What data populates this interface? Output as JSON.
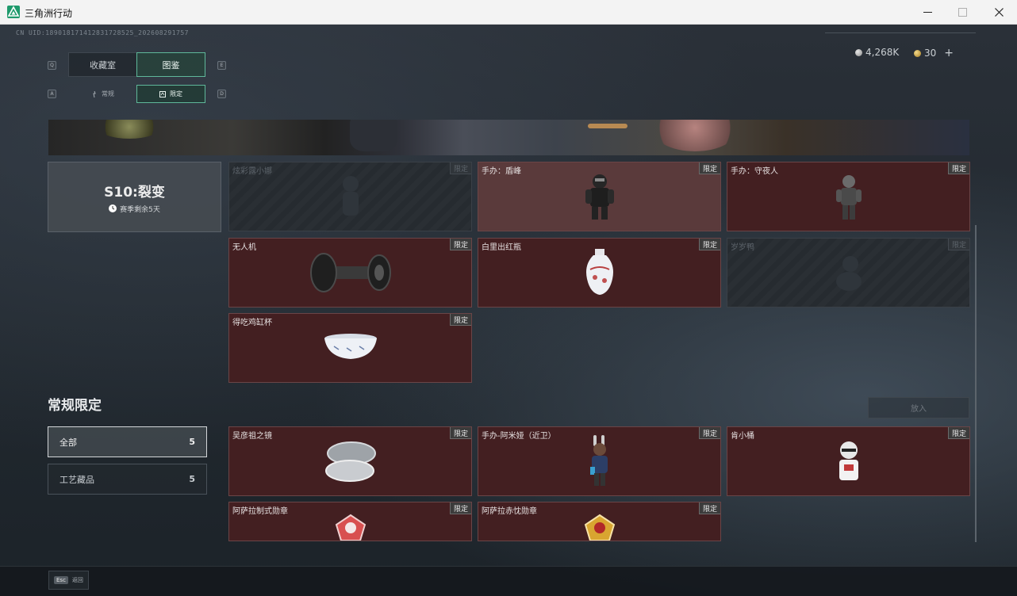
{
  "window": {
    "title": "三角洲行动"
  },
  "header": {
    "uid": "CN UID:18901817141283172852​5_202608291757",
    "currency_1": "4,268K",
    "currency_2": "30",
    "plus": "+"
  },
  "tabs": {
    "main": [
      {
        "label": "收藏室",
        "key": "Q"
      },
      {
        "label": "图鉴",
        "key": "E"
      }
    ],
    "sub": [
      {
        "label": "常规",
        "key": "A"
      },
      {
        "label": "限定",
        "key": "D"
      }
    ]
  },
  "season": {
    "title": "S10:裂变",
    "remaining": "赛季剩余5天"
  },
  "tag": "限定",
  "season_items": [
    {
      "name": "炫彩露小娜"
    },
    {
      "name": "手办：盾峰"
    },
    {
      "name": "手办：守夜人"
    },
    {
      "name": "无人机"
    },
    {
      "name": "白里出红瓶"
    },
    {
      "name": "岁岁鸭"
    },
    {
      "name": "得吃鸡缸杯"
    }
  ],
  "section": {
    "title": "常规限定",
    "put_button": "放入"
  },
  "filters": [
    {
      "label": "全部",
      "count": "5"
    },
    {
      "label": "工艺藏品",
      "count": "5"
    }
  ],
  "regular_items": [
    {
      "name": "吴彦祖之镜"
    },
    {
      "name": "手办-阿米娅（近卫）"
    },
    {
      "name": "肯小桶"
    },
    {
      "name": "阿萨拉制式勋章"
    },
    {
      "name": "阿萨拉赤忱勋章"
    }
  ],
  "footer": {
    "esc_key": "Esc",
    "back": "返回"
  },
  "colors": {
    "accent": "#5fb89a",
    "card_bg": "#431f21",
    "card_border": "#6a4547"
  }
}
